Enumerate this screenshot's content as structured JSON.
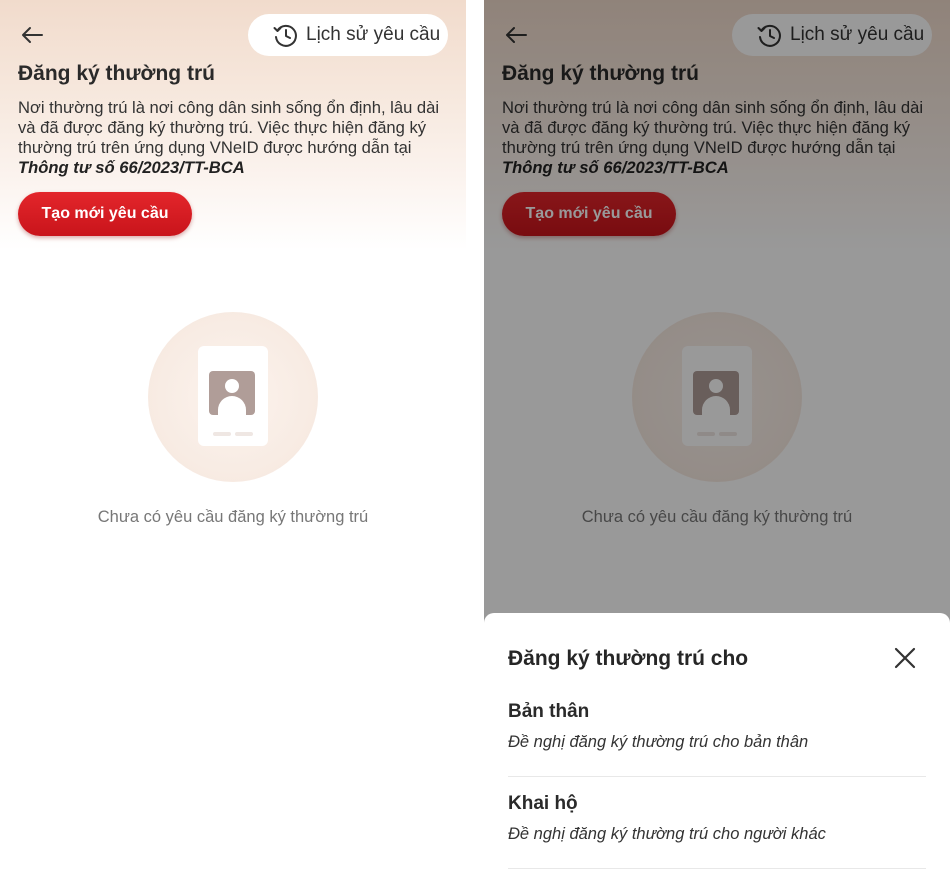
{
  "header": {
    "history_label": "Lịch sử yêu cầu",
    "back_icon": "arrow-left-icon",
    "history_icon": "history-clock-icon"
  },
  "page": {
    "title": "Đăng ký thường trú",
    "description": "Nơi thường trú là nơi công dân sinh sống ổn định, lâu dài và đã được đăng ký thường trú. Việc thực hiện đăng ký thường trú trên ứng dụng VNeID được hướng dẫn tại",
    "doc_ref": "Thông tư số 66/2023/TT-BCA",
    "create_button": "Tạo mới yêu cầu"
  },
  "empty_state": {
    "icon": "id-card-icon",
    "text": "Chưa có yêu cầu đăng ký thường trú"
  },
  "sheet": {
    "title": "Đăng ký thường trú cho",
    "close_icon": "close-icon",
    "options": [
      {
        "title": "Bản thân",
        "subtitle": "Đề nghị đăng ký thường trú cho bản thân"
      },
      {
        "title": "Khai hộ",
        "subtitle": "Đề nghị đăng ký thường trú cho người khác"
      }
    ]
  },
  "colors": {
    "accent_red": "#d71920",
    "header_tint": "#f1dbcc",
    "overlay": "rgba(0,0,0,0.40)"
  }
}
